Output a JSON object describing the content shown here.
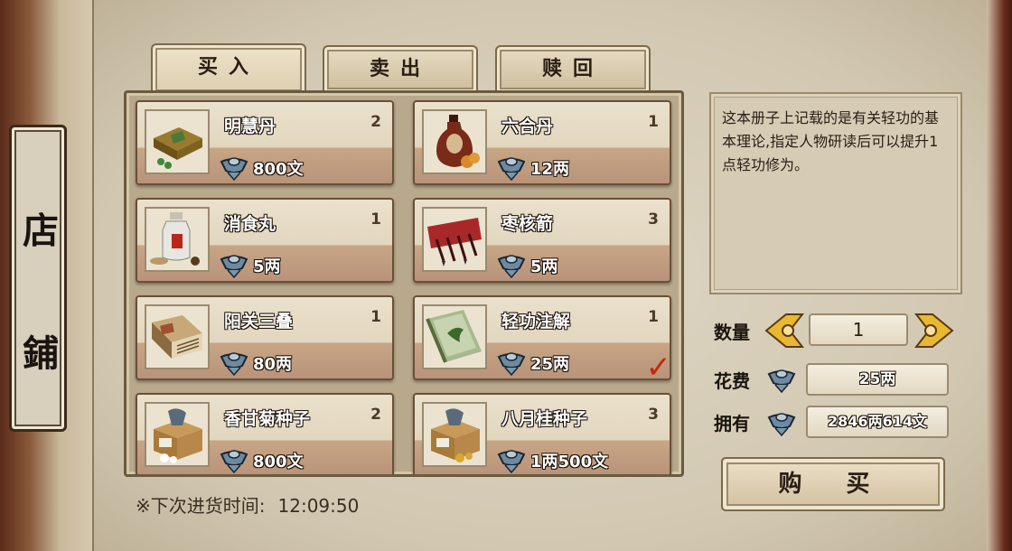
{
  "sidebar": {
    "chars": [
      "店",
      "鋪"
    ]
  },
  "tabs": [
    {
      "label": "买入",
      "active": true
    },
    {
      "label": "卖出",
      "active": false
    },
    {
      "label": "赎回",
      "active": false
    }
  ],
  "items": [
    {
      "name": "明慧丹",
      "count": "2",
      "price": "800文",
      "icon": "medicine-box-icon"
    },
    {
      "name": "六合丹",
      "count": "1",
      "price": "12两",
      "icon": "gourd-bottle-icon"
    },
    {
      "name": "消食丸",
      "count": "1",
      "price": "5两",
      "icon": "pill-jar-icon"
    },
    {
      "name": "枣核箭",
      "count": "3",
      "price": "5两",
      "icon": "darts-icon"
    },
    {
      "name": "阳关三叠",
      "count": "1",
      "price": "80两",
      "icon": "book-icon"
    },
    {
      "name": "轻功注解",
      "count": "1",
      "price": "25两",
      "icon": "scroll-icon",
      "selected": true
    },
    {
      "name": "香甘菊种子",
      "count": "2",
      "price": "800文",
      "icon": "seed-crate-icon"
    },
    {
      "name": "八月桂种子",
      "count": "3",
      "price": "1两500文",
      "icon": "seed-crate-icon"
    }
  ],
  "restock": {
    "label": "※下次进货时间:",
    "time": "12:09:50"
  },
  "description": "这本册子上记载的是有关轻功的基本理论,指定人物研读后可以提升1点轻功修为。",
  "quantity": {
    "label": "数量",
    "value": "1"
  },
  "cost": {
    "label": "花费",
    "value": "25两"
  },
  "owned": {
    "label": "拥有",
    "value": "2846两614文"
  },
  "buy_label": "购 买",
  "colors": {
    "accent_check": "#c22a08",
    "paper": "#d9d0bd"
  }
}
